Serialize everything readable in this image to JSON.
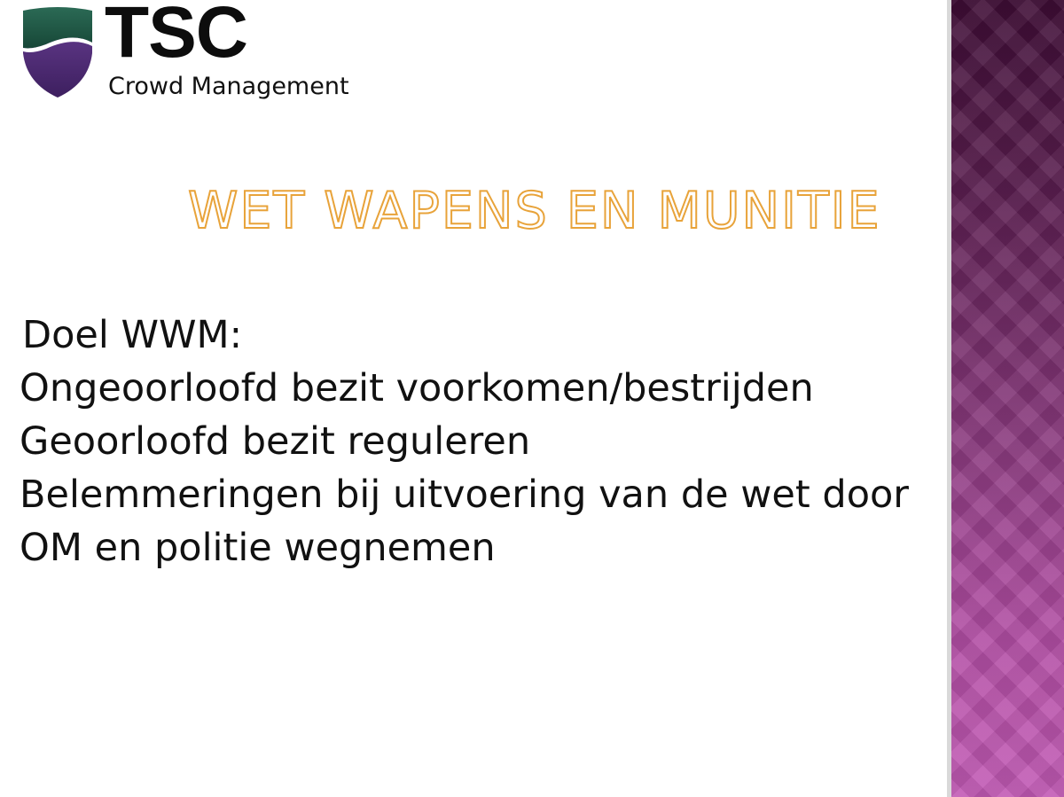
{
  "logo": {
    "name": "TSC",
    "subtitle": "Crowd Management"
  },
  "slide": {
    "title": "WET WAPENS EN MUNITIE",
    "heading": "Doel WWM:",
    "lines": [
      "Ongeoorloofd bezit voorkomen/bestrijden",
      "Geoorloofd bezit reguleren",
      "Belemmeringen bij uitvoering van de wet door",
      "OM en politie wegnemen"
    ]
  },
  "colors": {
    "title_outline": "#e8a33a",
    "shield_top": "#1e5a45",
    "shield_bottom": "#4b2a6e",
    "side_panel": "#7a2a6e"
  }
}
